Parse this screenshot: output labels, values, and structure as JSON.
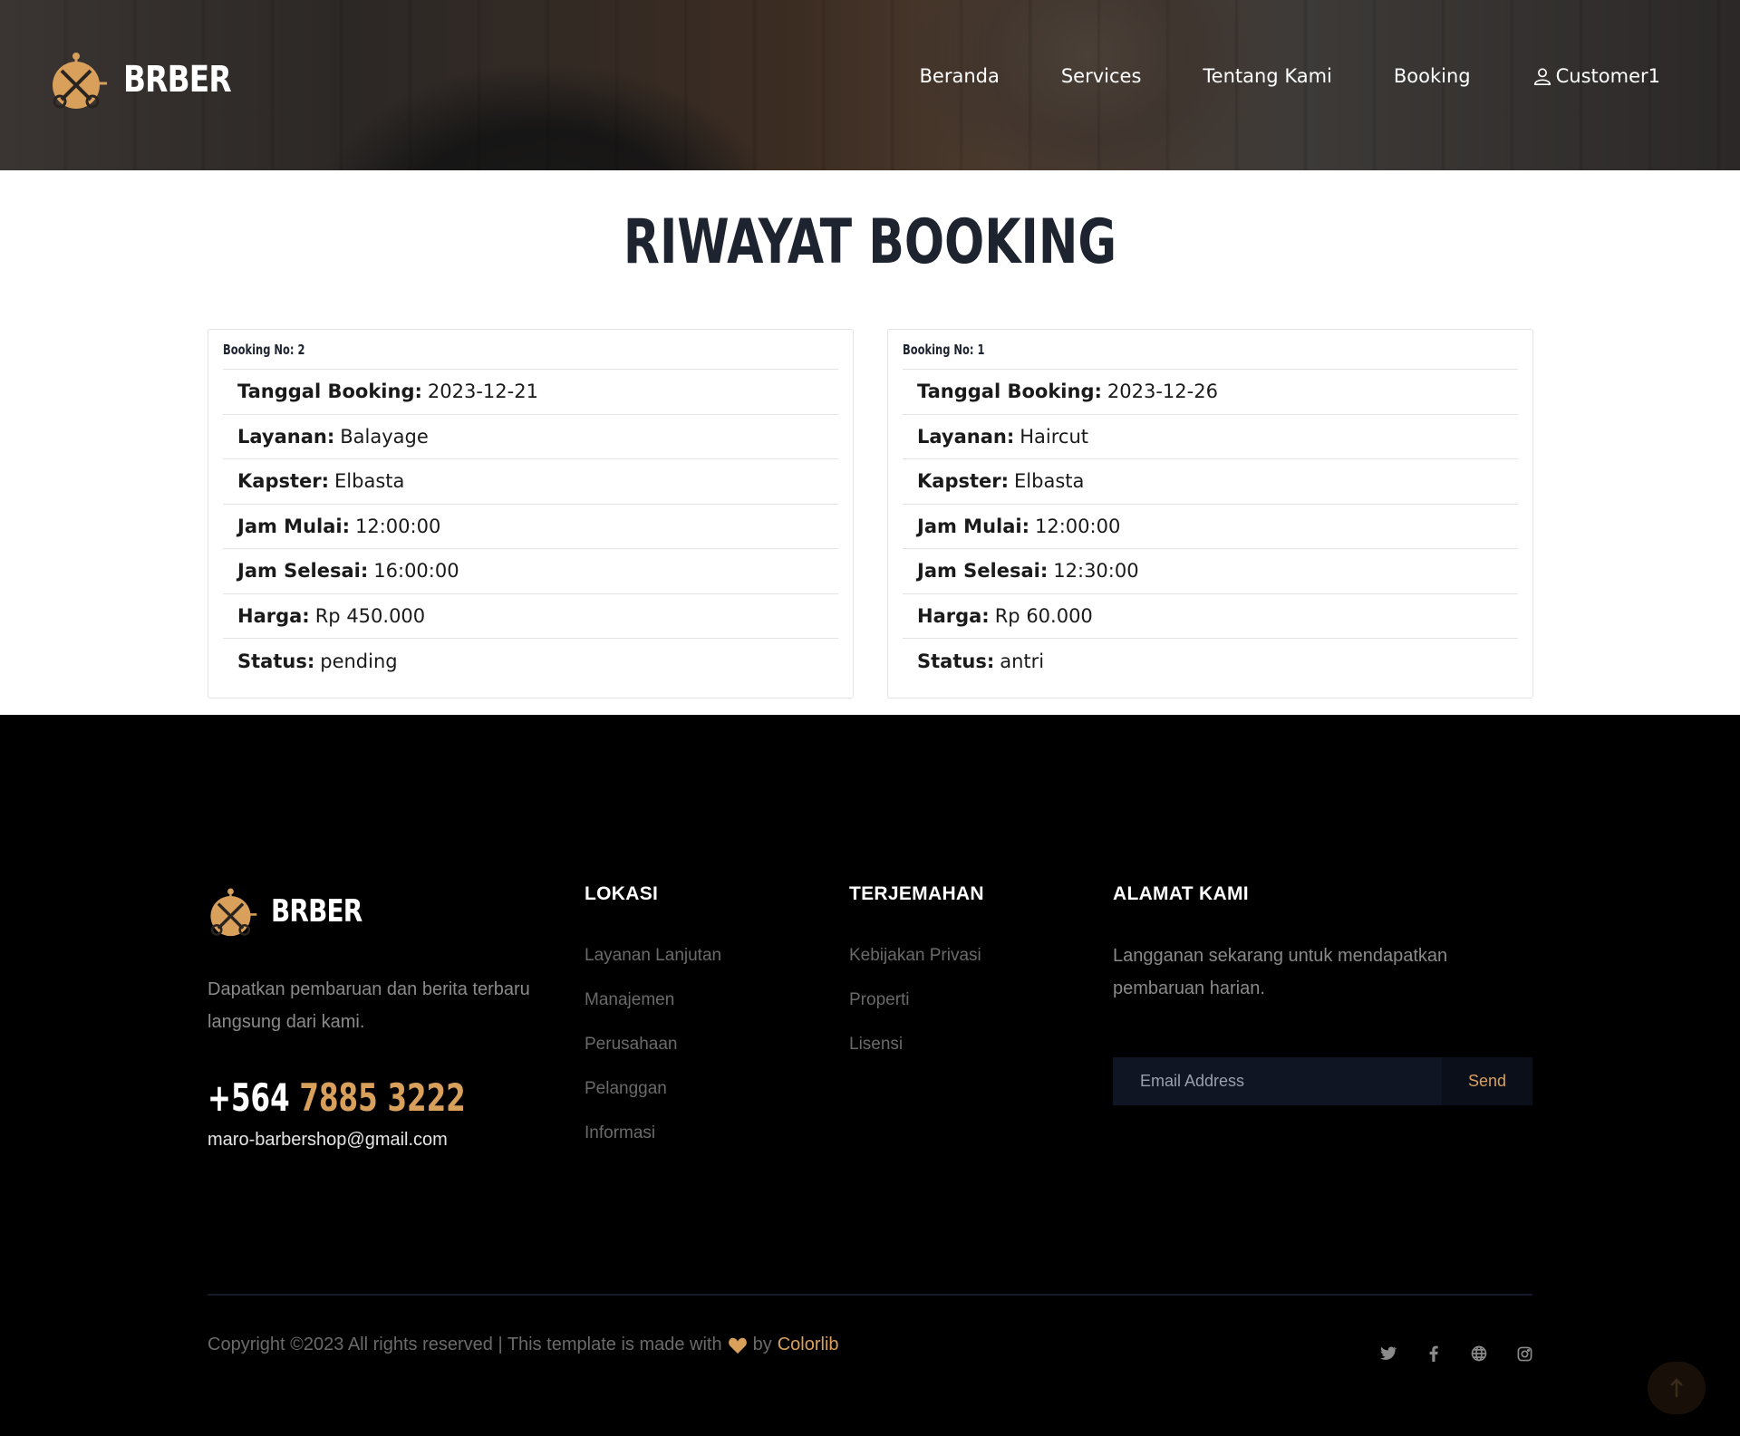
{
  "brand": {
    "name": "BRBER"
  },
  "nav": {
    "items": [
      "Beranda",
      "Services",
      "Tentang Kami",
      "Booking"
    ],
    "user": "Customer1"
  },
  "page": {
    "title": "RIWAYAT BOOKING"
  },
  "bookings": [
    {
      "header": "Booking No: 2",
      "fields": [
        {
          "label": "Tanggal Booking:",
          "value": "2023-12-21"
        },
        {
          "label": "Layanan:",
          "value": "Balayage"
        },
        {
          "label": "Kapster:",
          "value": "Elbasta"
        },
        {
          "label": "Jam Mulai:",
          "value": "12:00:00"
        },
        {
          "label": "Jam Selesai:",
          "value": "16:00:00"
        },
        {
          "label": "Harga:",
          "value": "Rp 450.000"
        },
        {
          "label": "Status:",
          "value": "pending"
        }
      ]
    },
    {
      "header": "Booking No: 1",
      "fields": [
        {
          "label": "Tanggal Booking:",
          "value": "2023-12-26"
        },
        {
          "label": "Layanan:",
          "value": "Haircut"
        },
        {
          "label": "Kapster:",
          "value": "Elbasta"
        },
        {
          "label": "Jam Mulai:",
          "value": "12:00:00"
        },
        {
          "label": "Jam Selesai:",
          "value": "12:30:00"
        },
        {
          "label": "Harga:",
          "value": "Rp 60.000"
        },
        {
          "label": "Status:",
          "value": "antri"
        }
      ]
    }
  ],
  "footer": {
    "description": "Dapatkan pembaruan dan berita terbaru langsung dari kami.",
    "phone_prefix": "+564",
    "phone_number": "7885 3222",
    "email": "maro-barbershop@gmail.com",
    "col_lokasi": {
      "title": "LOKASI",
      "items": [
        "Layanan Lanjutan",
        "Manajemen",
        "Perusahaan",
        "Pelanggan",
        "Informasi"
      ]
    },
    "col_terjemahan": {
      "title": "TERJEMAHAN",
      "items": [
        "Kebijakan Privasi",
        "Properti",
        "Lisensi"
      ]
    },
    "col_alamat": {
      "title": "ALAMAT KAMI",
      "text": "Langganan sekarang untuk mendapatkan pembaruan harian."
    },
    "subscribe": {
      "placeholder": "Email Address",
      "button": "Send"
    },
    "copyright_text": "Copyright ©2023 All rights reserved | This template is made with",
    "copyright_by": "by",
    "copyright_brand": "Colorlib"
  },
  "icons": {
    "logo": "scissors-logo-icon",
    "user": "user-icon",
    "heart": "heart-icon",
    "socials": [
      "twitter-icon",
      "facebook-icon",
      "globe-icon",
      "instagram-icon"
    ],
    "to_top": "arrow-up-icon"
  },
  "colors": {
    "accent": "#d9a05b",
    "title": "#1e2330",
    "footer_bg": "#000000"
  }
}
